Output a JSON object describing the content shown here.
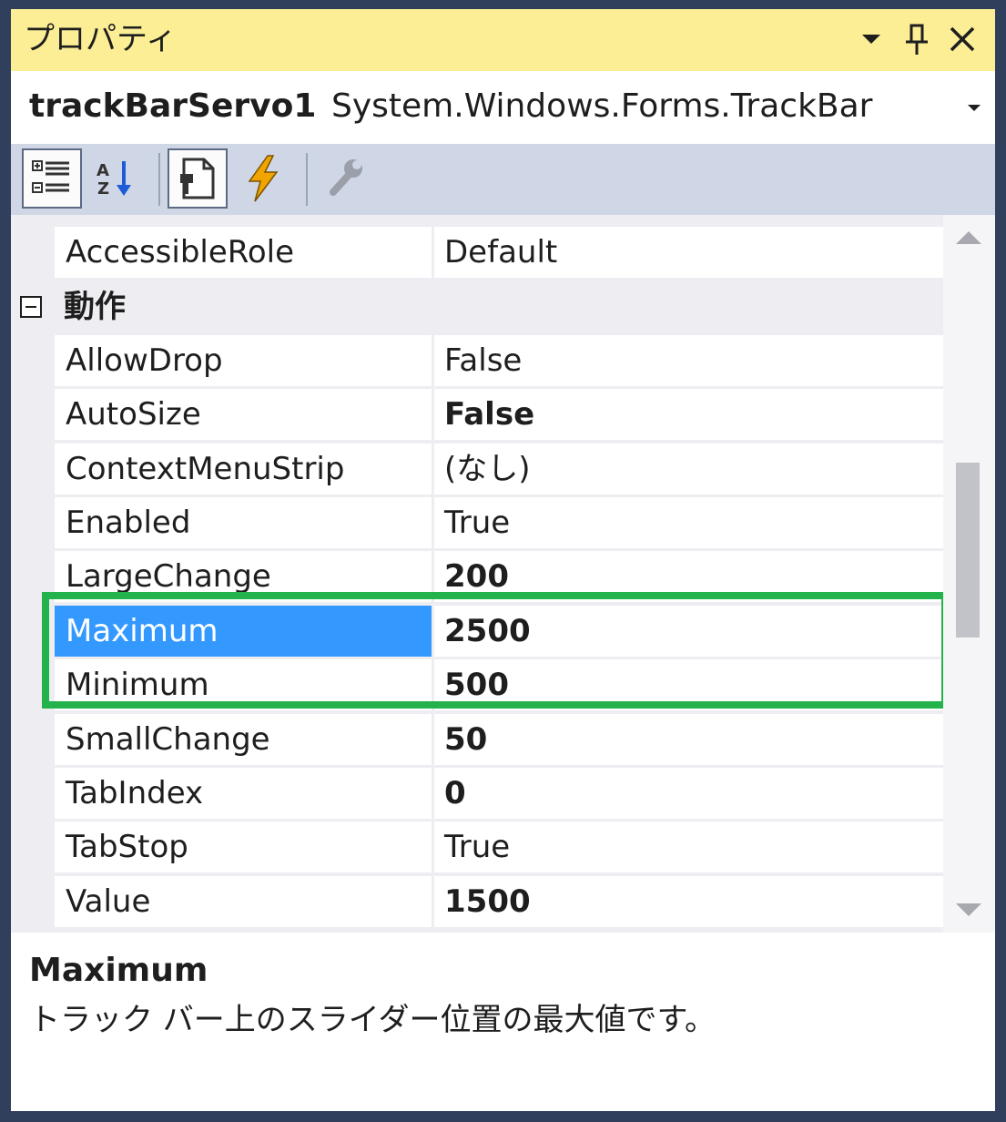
{
  "panel": {
    "title": "プロパティ",
    "dropdown_glyph": "▾",
    "pin_glyph": "📌",
    "close_glyph": "✕"
  },
  "object_selector": {
    "name": "trackBarServo1",
    "type": "System.Windows.Forms.TrackBar"
  },
  "toolbar": {
    "buttons": [
      {
        "name": "categorized",
        "icon": "categorized-icon",
        "active": true
      },
      {
        "name": "alphabetical",
        "icon": "sort-az-icon",
        "active": false
      },
      {
        "name": "properties",
        "icon": "properties-icon",
        "active": true
      },
      {
        "name": "events",
        "icon": "lightning-icon",
        "active": false
      },
      {
        "name": "property-pages",
        "icon": "wrench-icon",
        "active": false
      }
    ]
  },
  "grid": {
    "rows": [
      {
        "name": "AccessibleRole",
        "value": "Default",
        "bold": false
      },
      {
        "category": "動作"
      },
      {
        "name": "AllowDrop",
        "value": "False",
        "bold": false
      },
      {
        "name": "AutoSize",
        "value": "False",
        "bold": true
      },
      {
        "name": "ContextMenuStrip",
        "value": "(なし)",
        "bold": false
      },
      {
        "name": "Enabled",
        "value": "True",
        "bold": false
      },
      {
        "name": "LargeChange",
        "value": "200",
        "bold": true
      },
      {
        "name": "Maximum",
        "value": "2500",
        "bold": true,
        "selected": true
      },
      {
        "name": "Minimum",
        "value": "500",
        "bold": true
      },
      {
        "name": "SmallChange",
        "value": "50",
        "bold": true
      },
      {
        "name": "TabIndex",
        "value": "0",
        "bold": true
      },
      {
        "name": "TabStop",
        "value": "True",
        "bold": false
      },
      {
        "name": "Value",
        "value": "1500",
        "bold": true
      }
    ],
    "highlight_color": "#23b24c",
    "selection_color": "#3399ff"
  },
  "description": {
    "title": "Maximum",
    "text": "トラック バー上のスライダー位置の最大値です。"
  }
}
